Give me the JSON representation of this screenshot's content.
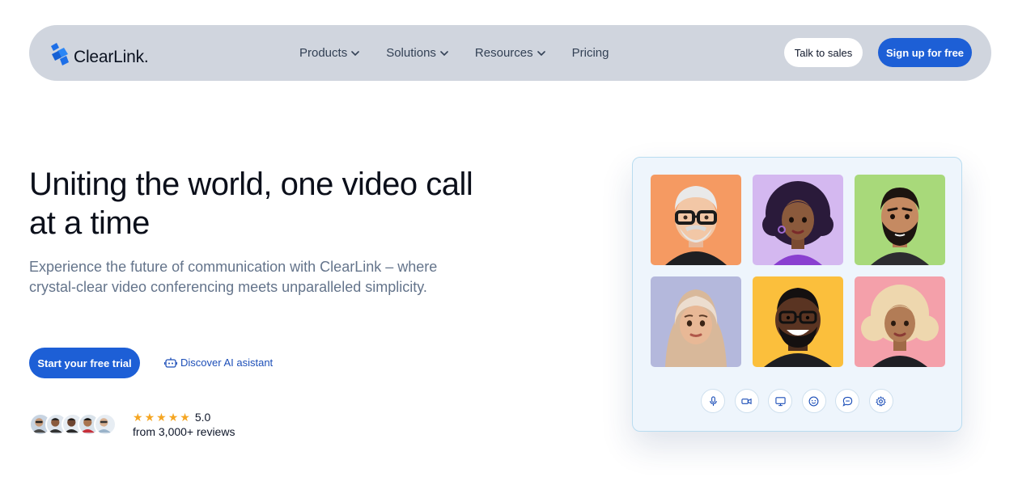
{
  "nav": {
    "logo_text": "ClearLink.",
    "links": [
      {
        "label": "Products",
        "has_dropdown": true
      },
      {
        "label": "Solutions",
        "has_dropdown": true
      },
      {
        "label": "Resources",
        "has_dropdown": true
      },
      {
        "label": "Pricing",
        "has_dropdown": false
      }
    ],
    "talk_to_sales": "Talk to sales",
    "sign_up": "Sign up for free"
  },
  "hero": {
    "title": "Uniting the world, one video call at a time",
    "subtitle": "Experience the future of communication with ClearLink – where crystal-clear video conferencing meets unparalleled simplicity.",
    "cta_primary": "Start your free trial",
    "cta_secondary": "Discover AI asistant",
    "rating": {
      "stars": 5,
      "value": "5.0",
      "reviews_text": "from 3,000+ reviews"
    }
  },
  "video_card": {
    "participants": [
      {
        "name": "older-man-avatar",
        "bg": "#f59a62"
      },
      {
        "name": "curly-hair-woman-avatar",
        "bg": "#d4b8f0"
      },
      {
        "name": "bearded-man-avatar",
        "bg": "#a8d97a"
      },
      {
        "name": "hijab-woman-avatar",
        "bg": "#b4b8dc"
      },
      {
        "name": "smiling-man-glasses-avatar",
        "bg": "#fbbf3c"
      },
      {
        "name": "blonde-woman-avatar",
        "bg": "#f4a0aa"
      }
    ],
    "controls": [
      "microphone-icon",
      "camera-icon",
      "screen-share-icon",
      "emoji-icon",
      "chat-icon",
      "settings-icon"
    ]
  },
  "colors": {
    "nav_bg": "#d0d5de",
    "primary": "#1d5fd6",
    "star": "#f5a623",
    "card_bg": "#eef5fc"
  }
}
